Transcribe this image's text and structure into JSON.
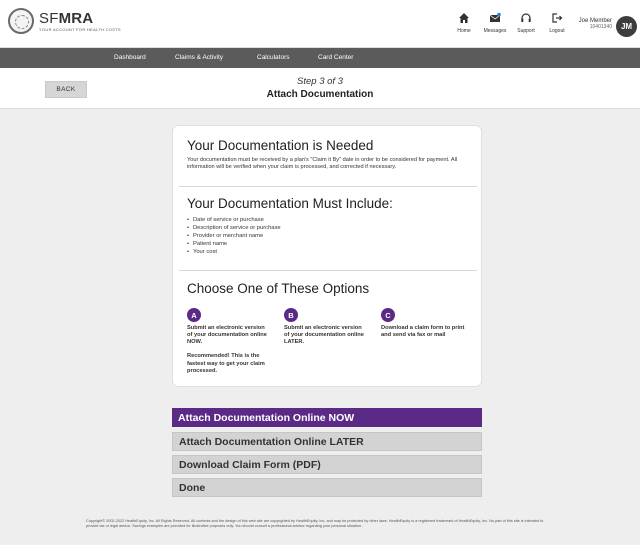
{
  "header": {
    "brand_prefix": "SF",
    "brand_bold": "MRA",
    "brand_tagline": "YOUR ACCOUNT FOR HEALTH COSTS",
    "icons": [
      {
        "name": "home-icon",
        "label": "Home"
      },
      {
        "name": "messages-icon",
        "label": "Messages"
      },
      {
        "name": "support-icon",
        "label": "Support"
      },
      {
        "name": "logout-icon",
        "label": "Logout"
      }
    ],
    "user_name": "Joe Member",
    "user_id": "10401340",
    "avatar_initials": "JM"
  },
  "nav": {
    "items": [
      "Dashboard",
      "Claims & Activity",
      "Calculators",
      "Card Center"
    ]
  },
  "stepbar": {
    "back_label": "BACK",
    "step_label": "Step 3 of 3",
    "title": "Attach Documentation"
  },
  "card": {
    "needed": {
      "heading": "Your Documentation is Needed",
      "body": "Your documentation must be received by a plan's \"Claim it By\" date in order to be considered for payment. All information will be verified when your claim is processed, and corrected if necessary."
    },
    "include": {
      "heading": "Your Documentation Must Include:",
      "items": [
        "Date of service or purchase",
        "Description of service or purchase",
        "Provider or merchant name",
        "Patient name",
        "Your cost"
      ]
    },
    "options": {
      "heading": "Choose One of These Options",
      "items": [
        {
          "letter": "A",
          "text": "Submit an electronic version of your documentation online NOW.",
          "note": "Recommended! This is the fastest way to get your claim processed."
        },
        {
          "letter": "B",
          "text": "Submit an electronic version of your documentation online LATER.",
          "note": ""
        },
        {
          "letter": "C",
          "text": "Download a claim form to print and send via fax or mail",
          "note": ""
        }
      ]
    }
  },
  "actions": {
    "attach_now": "Attach Documentation Online NOW",
    "attach_later": "Attach Documentation Online LATER",
    "download_form": "Download Claim Form (PDF)",
    "done": "Done"
  },
  "footer": {
    "text": "Copyright© 2002-2022 HealthEquity, Inc. All Rights Reserved. All contents and the design of this web site are copyrighted by HealthEquity, Inc. and may be protected by other laws. HealthEquity is a registered trademark of HealthEquity, Inc. No part of this site is intended to provide tax or legal advice. Savings examples are provided for illustrative purposes only. You should consult a professional advisor regarding your personal situation."
  },
  "colors": {
    "accent": "#5b2a86",
    "nav_bg": "#5b5b5b",
    "page_bg": "#eeeeee"
  }
}
